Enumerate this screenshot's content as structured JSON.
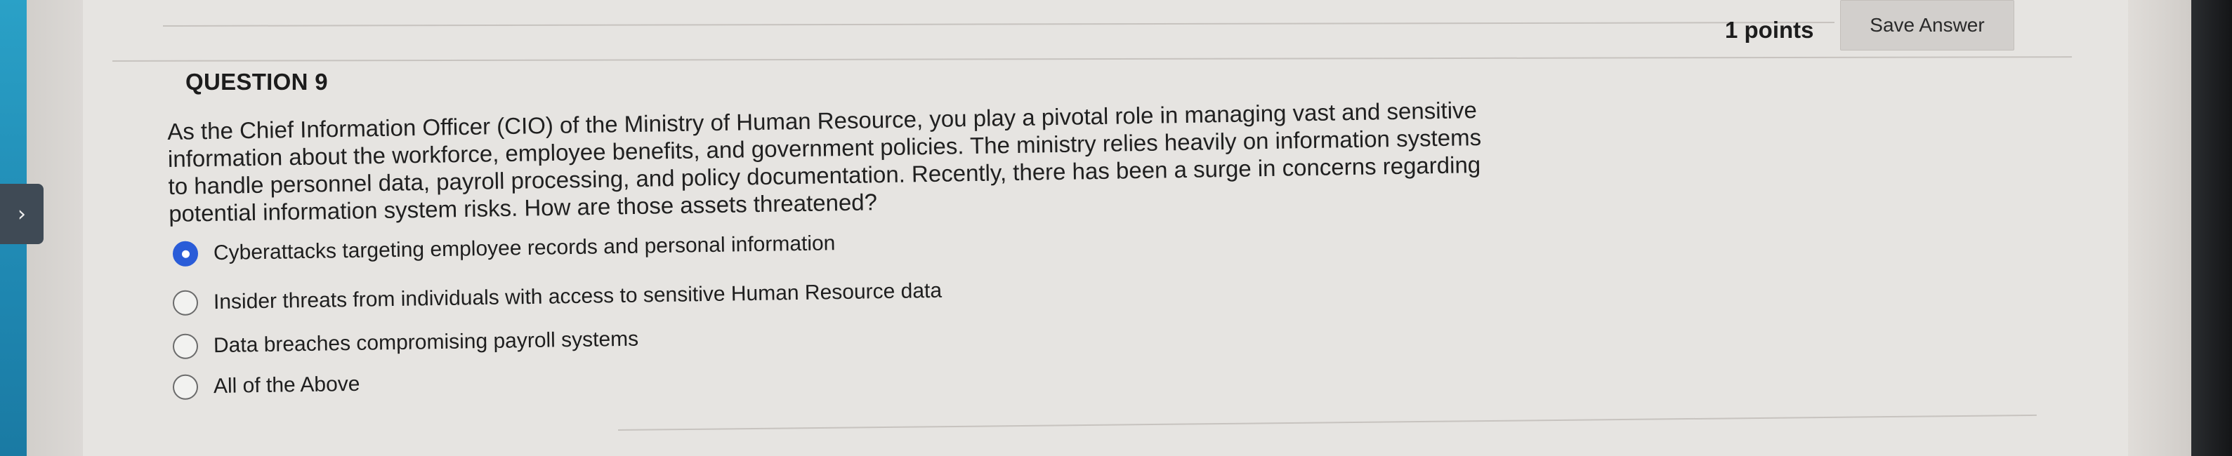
{
  "header": {
    "points_label": "1 points",
    "save_label": "Save Answer"
  },
  "question": {
    "title": "QUESTION 9",
    "text_lines": [
      "As the Chief Information Officer (CIO) of the Ministry of Human Resource, you play a pivotal role in managing vast and sensitive",
      "information about the workforce, employee benefits, and government policies. The ministry relies heavily on information systems",
      "to handle personnel data, payroll processing, and policy documentation. Recently, there has been a surge in concerns regarding",
      "potential information system risks. How are those assets threatened?"
    ],
    "options": [
      {
        "label": "Cyberattacks targeting employee records and personal information",
        "selected": true
      },
      {
        "label": "Insider threats from individuals with access to sensitive Human Resource data",
        "selected": false
      },
      {
        "label": "Data breaches compromising payroll systems",
        "selected": false
      },
      {
        "label": "All of the Above",
        "selected": false
      }
    ]
  },
  "sidebar": {
    "expand_icon": "chevron-right-icon"
  },
  "colors": {
    "accent_blue": "#2a5cd8",
    "left_strip": "#1f88b2",
    "panel_bg": "#e6e4e1"
  }
}
